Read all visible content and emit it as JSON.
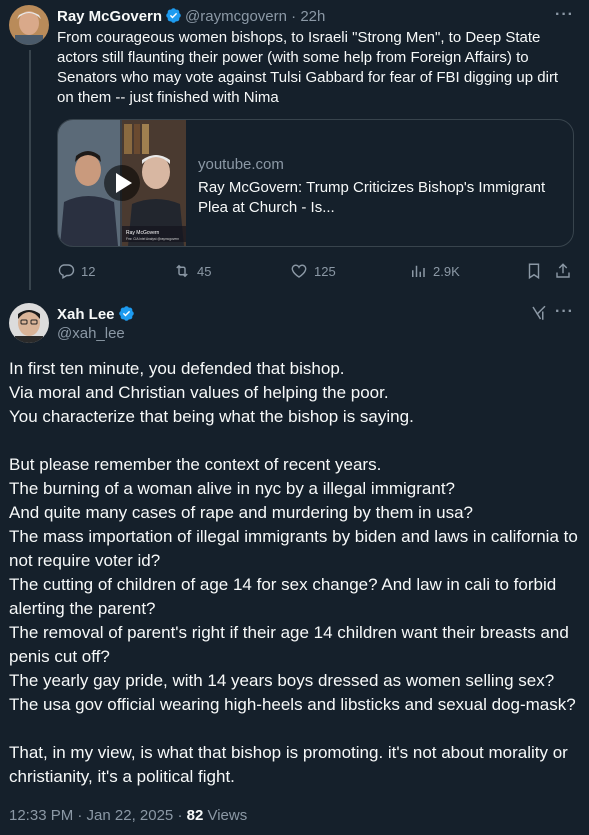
{
  "colors": {
    "background": "#15202b",
    "text": "#f7f9f9",
    "secondary": "#8b98a5",
    "verified": "#1d9bf0",
    "border": "#38444d"
  },
  "tweet1": {
    "name": "Ray McGovern",
    "handle": "@raymcgovern",
    "time": "22h",
    "text": "From courageous women bishops, to Israeli \"Strong Men\", to Deep State actors still flaunting their power (with some help from Foreign Affairs) to Senators who may vote against Tulsi Gabbard for fear of FBI digging up dirt on them -- just finished with Nima",
    "card": {
      "domain": "youtube.com",
      "title": "Ray McGovern: Trump Criticizes Bishop's Immigrant Plea at Church - Is...",
      "thumb_caption": "Ray McGovern",
      "thumb_subcaption": "Fmr. CIA Intel Analyst @raymcgovern"
    },
    "actions": {
      "replies": "12",
      "reposts": "45",
      "likes": "125",
      "views": "2.9K"
    }
  },
  "tweet2": {
    "name": "Xah Lee",
    "handle": "@xah_lee",
    "paragraphs": [
      [
        "In first ten minute, you defended that bishop.",
        "Via moral and Christian values of helping the poor.",
        "You characterize that being what the bishop is saying."
      ],
      [
        "But please remember the context of recent years.",
        "The burning of a woman alive in nyc by a illegal immigrant?",
        "And quite many cases of rape and murdering by them in usa?",
        "The mass importation of illegal immigrants by biden and laws in california to not require voter id?",
        "The cutting of children of age 14 for sex change? And law in cali to forbid alerting the parent?",
        "The removal of parent's right if their age 14 children want their breasts and penis cut off?",
        "The yearly gay pride, with 14 years boys dressed as women selling sex?",
        "The usa gov official wearing high-heels and libsticks and sexual dog-mask?"
      ],
      [
        "That, in my view, is what that bishop is promoting. it's not about morality or christianity, it's a political fight."
      ]
    ],
    "timestamp": "12:33 PM · Jan 22, 2025 · ",
    "views_count": "82",
    "views_label": " Views"
  }
}
